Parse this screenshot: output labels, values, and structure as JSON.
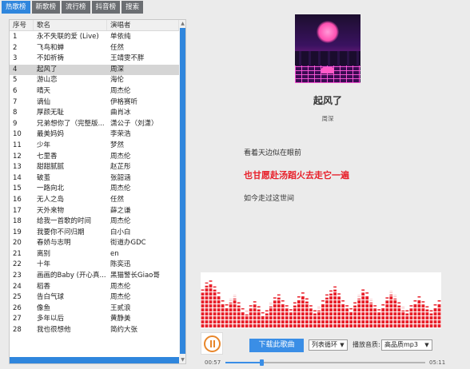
{
  "tabs": [
    {
      "label": "热歌榜",
      "active": true
    },
    {
      "label": "新歌榜",
      "active": false
    },
    {
      "label": "流行榜",
      "active": false
    },
    {
      "label": "抖音榜",
      "active": false
    },
    {
      "label": "搜索",
      "active": false
    }
  ],
  "table": {
    "headers": {
      "no": "序号",
      "name": "歌名",
      "artist": "演唱者"
    },
    "rows": [
      {
        "no": "1",
        "name": "永不失联的爱 (Live)",
        "artist": "单依纯"
      },
      {
        "no": "2",
        "name": "飞鸟和蝉",
        "artist": "任然"
      },
      {
        "no": "3",
        "name": "不如祈祷",
        "artist": "王靖雯不胖"
      },
      {
        "no": "4",
        "name": "起风了",
        "artist": "周深"
      },
      {
        "no": "5",
        "name": "游山恋",
        "artist": "海伦"
      },
      {
        "no": "6",
        "name": "晴天",
        "artist": "周杰伦"
      },
      {
        "no": "7",
        "name": "谪仙",
        "artist": "伊格赛听"
      },
      {
        "no": "8",
        "name": "厚颜无耻",
        "artist": "曲肖冰"
      },
      {
        "no": "9",
        "name": "兄弟想你了（完整版...",
        "artist": "潇公子（刘潇）"
      },
      {
        "no": "10",
        "name": "最美妈妈",
        "artist": "李荣浩"
      },
      {
        "no": "11",
        "name": "少年",
        "artist": "梦然"
      },
      {
        "no": "12",
        "name": "七里香",
        "artist": "周杰伦"
      },
      {
        "no": "13",
        "name": "甜甜腻腻",
        "artist": "赵芷彤"
      },
      {
        "no": "14",
        "name": "破茧",
        "artist": "张韶涵"
      },
      {
        "no": "15",
        "name": "一路向北",
        "artist": "周杰伦"
      },
      {
        "no": "16",
        "name": "无人之岛",
        "artist": "任然"
      },
      {
        "no": "17",
        "name": "天外来物",
        "artist": "薛之谦"
      },
      {
        "no": "18",
        "name": "给我一首歌的时间",
        "artist": "周杰伦"
      },
      {
        "no": "19",
        "name": "我要你不问归期",
        "artist": "白小白"
      },
      {
        "no": "20",
        "name": "春娇与志明",
        "artist": "街道办GDC"
      },
      {
        "no": "21",
        "name": "离别",
        "artist": "en"
      },
      {
        "no": "22",
        "name": "十年",
        "artist": "陈奕迅"
      },
      {
        "no": "23",
        "name": "画画的Baby (开心真...",
        "artist": "黑猫警长Giao哥"
      },
      {
        "no": "24",
        "name": "稻香",
        "artist": "周杰伦"
      },
      {
        "no": "25",
        "name": "告白气球",
        "artist": "周杰伦"
      },
      {
        "no": "26",
        "name": "像鱼",
        "artist": "王贰浪"
      },
      {
        "no": "27",
        "name": "多年以后",
        "artist": "黄静美"
      },
      {
        "no": "28",
        "name": "我也很想他",
        "artist": "简约大张"
      }
    ],
    "selected_index": 3
  },
  "now_playing": {
    "title": "起风了",
    "artist": "周深",
    "lyrics": [
      {
        "text": "看着天边似在眼前",
        "current": false
      },
      {
        "text": "也甘愿赴汤蹈火去走它一遍",
        "current": true
      },
      {
        "text": "如今走过这世间",
        "current": false
      }
    ]
  },
  "spectrum": {
    "color": "#e8202a",
    "levels": [
      0.72,
      0.86,
      0.9,
      0.78,
      0.66,
      0.5,
      0.42,
      0.52,
      0.6,
      0.46,
      0.34,
      0.28,
      0.4,
      0.48,
      0.38,
      0.26,
      0.3,
      0.44,
      0.56,
      0.62,
      0.5,
      0.4,
      0.32,
      0.46,
      0.58,
      0.66,
      0.54,
      0.4,
      0.3,
      0.36,
      0.5,
      0.62,
      0.7,
      0.78,
      0.64,
      0.5,
      0.4,
      0.34,
      0.46,
      0.6,
      0.72,
      0.66,
      0.52,
      0.4,
      0.32,
      0.42,
      0.56,
      0.68,
      0.6,
      0.46,
      0.36,
      0.3,
      0.4,
      0.5,
      0.58,
      0.48,
      0.38,
      0.3,
      0.42,
      0.5
    ]
  },
  "controls": {
    "download_label": "下载此歌曲",
    "play_mode": "列表循环",
    "quality_label": "播放音质:",
    "quality_value": "高品质mp3",
    "time_current": "00:57",
    "time_total": "05:11",
    "progress": 0.18
  },
  "colors": {
    "accent": "#2f86dd",
    "lyric_current": "#e8202a",
    "pause": "#e8862a"
  }
}
